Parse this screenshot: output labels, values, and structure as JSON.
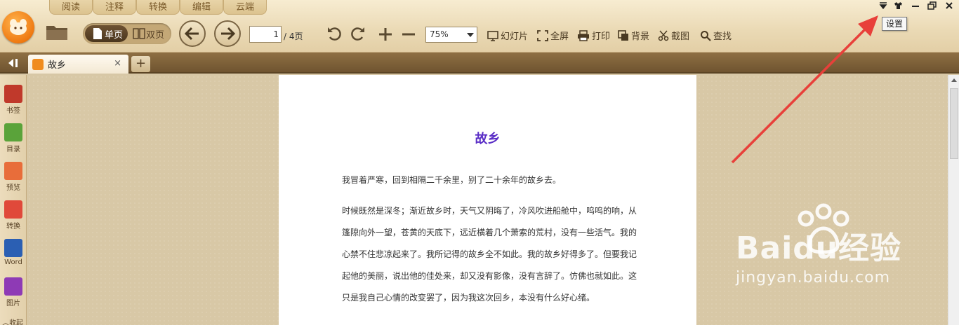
{
  "menu_tabs": [
    "阅读",
    "注释",
    "转换",
    "编辑",
    "云端"
  ],
  "toolbar": {
    "single_page": "单页",
    "double_page": "双页",
    "page_current": "1",
    "page_total": "/ 4页",
    "zoom": "75%",
    "slideshow": "幻灯片",
    "fullscreen": "全屏",
    "print": "打印",
    "background": "背景",
    "screenshot": "截图",
    "find": "查找"
  },
  "tooltip": "设置",
  "tab": {
    "title": "故乡",
    "close": "×",
    "add": "+"
  },
  "sidebar": [
    {
      "label": "书签",
      "color": "#c0392b"
    },
    {
      "label": "目录",
      "color": "#5aa33a"
    },
    {
      "label": "预览",
      "color": "#e86d3a"
    },
    {
      "label": "转换",
      "color": "#e0493a"
    },
    {
      "label": "Word",
      "color": "#2b5fb3"
    },
    {
      "label": "图片",
      "color": "#8e3ab5"
    },
    {
      "label": "收起",
      "color": "#5a4428"
    }
  ],
  "document": {
    "title": "故乡",
    "p1": "我冒着严寒，回到相隔二千余里，别了二十余年的故乡去。",
    "lines": [
      "时候既然是深冬；渐近故乡时，天气又阴晦了，冷风吹进船舱中，呜呜的响，从",
      "篷隙向外一望，苍黄的天底下，远近横着几个萧索的荒村，没有一些活气。我的",
      "心禁不住悲凉起来了。我所记得的故乡全不如此。我的故乡好得多了。但要我记",
      "起他的美丽，说出他的佳处来，却又没有影像，没有言辞了。仿佛也就如此。这",
      "只是我自己心情的改变罢了，因为我这次回乡，本没有什么好心绪。"
    ]
  },
  "watermark": {
    "main": "Baidu经验",
    "sub": "jingyan.baidu.com"
  },
  "colors": {
    "accent": "#ef7a12",
    "title": "#5a2ec6",
    "arrow": "#e8403a"
  }
}
